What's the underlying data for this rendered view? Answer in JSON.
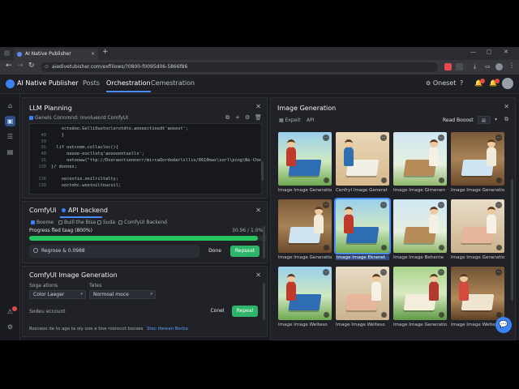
{
  "browser": {
    "tab_title": "AI Native Publisher",
    "url": "aiedivetubisher.com/exfiliows/?0800-f0095d06-5866f86"
  },
  "app": {
    "name": "AI Native Publisher",
    "nav": [
      "Posts",
      "Orchestration",
      "Cemestration"
    ],
    "active_nav": "Orchestration",
    "header_right_label": "Oneset",
    "accent": "#3b82f6"
  },
  "llm": {
    "title": "LLM Planning",
    "tool_a": "Genels",
    "tool_b": "Connmnd: Involueord ComfyUI",
    "code": [
      {
        "n": "",
        "t": "    octedoo.GelliOuetoclerotdto.anoeectioedt'aooest';"
      },
      {
        "n": "40",
        "t": "    }"
      },
      {
        "n": "50",
        "t": ""
      },
      {
        "n": "56",
        "t": "  lif outcoem.collaclec(){"
      },
      {
        "n": "48",
        "t": "      oeooe-eocllotq'aooooontuolls';"
      },
      {
        "n": "15",
        "t": "      ootooww(\"ttp://Dsoraoctiennorr/mircaOordodarlsllio/8610mas\\sorl\\ping\\Ne-Chee/\\stacolt"
      },
      {
        "n": "130",
        "t": "}/ doones;"
      },
      {
        "n": "",
        "t": ""
      },
      {
        "n": "138",
        "t": "    oecextie.onilriltalty;"
      },
      {
        "n": "139",
        "t": "    ooctohc.wootoiltoucsil;"
      }
    ]
  },
  "comfy": {
    "tab_1": "ComfyUi",
    "tab_2": "API backend",
    "options": [
      "Boome",
      "Buill the Bisa",
      "Suda",
      "ComfyUI Backend"
    ],
    "progress_label": "Progress fled taag (800%)",
    "progress_value": "30.96 / 1.0%",
    "progress_fraction": 0.96,
    "status_text": "Regrose & 0.0988",
    "done_label": "Done",
    "primary_label": "Repseat"
  },
  "gen": {
    "title": "ComfyUI Image Generation",
    "label_a": "Soga ations",
    "value_a": "Color Laeger",
    "label_b": "Tetes",
    "value_b": "Normoal moce",
    "label_c": "Sodeu eccount",
    "cancel_label": "Conel",
    "submit_label": "Repeal",
    "footer_text": "Rosceoo ite to age ta oly ooe a tine roorocot booses",
    "footer_link": "Stec tfwwan Berba"
  },
  "images": {
    "title": "Image Generation",
    "tool_a": "Expeit",
    "tool_b": "API",
    "tool_right": "Read Booost",
    "tiles": [
      {
        "cap": "Image Image Generatio",
        "scene": "kids"
      },
      {
        "cap": "Cenfryl Image Generat",
        "scene": "kids-book"
      },
      {
        "cap": "Image Image Gimenen",
        "scene": "book"
      },
      {
        "cap": "Image Image Generatio",
        "scene": "book-window"
      },
      {
        "cap": "Image Image Generatio",
        "scene": "book-window"
      },
      {
        "cap": "Image Image Ekneret",
        "scene": "kids"
      },
      {
        "cap": "Image Image Behente",
        "scene": "book"
      },
      {
        "cap": "Image Image Generatio",
        "scene": "book-hand"
      },
      {
        "cap": "Image Image Welteso",
        "scene": "kids"
      },
      {
        "cap": "Image Image Welteso",
        "scene": "book-hand"
      },
      {
        "cap": "Image Image Generatio",
        "scene": "books-stack"
      },
      {
        "cap": "Image Image Welteso",
        "scene": "kids-window"
      }
    ],
    "selected_index": 5
  }
}
